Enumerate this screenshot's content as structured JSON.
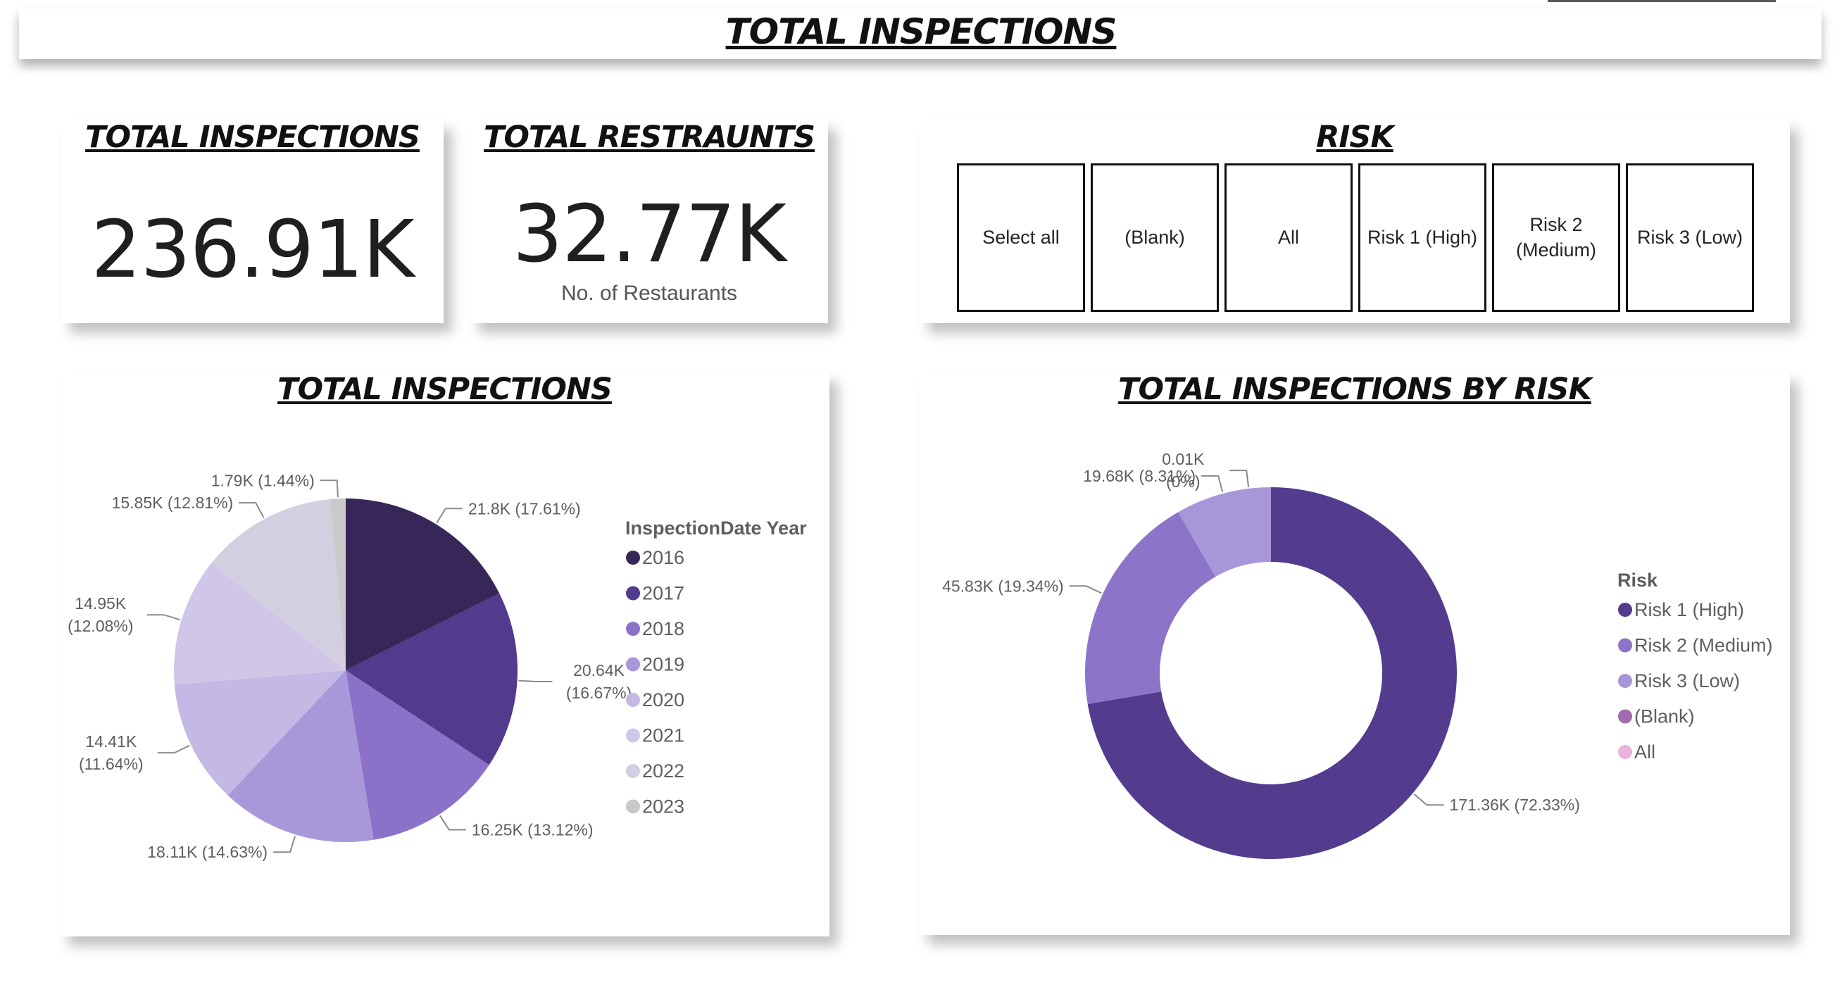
{
  "page": {
    "title": "TOTAL INSPECTIONS"
  },
  "kpis": {
    "inspections": {
      "title": "TOTAL INSPECTIONS",
      "value": "236.91K"
    },
    "restaurants": {
      "title": "TOTAL RESTRAUNTS",
      "value": "32.77K",
      "caption": "No. of Restaurants"
    }
  },
  "risk_slicer": {
    "title": "RISK",
    "options": [
      "Select all",
      "(Blank)",
      "All",
      "Risk 1 (High)",
      "Risk 2\n(Medium)",
      "Risk 3 (Low)"
    ]
  },
  "chart_data": [
    {
      "type": "pie",
      "title": "TOTAL INSPECTIONS",
      "legend_title": "InspectionDate Year",
      "legend_position": "right",
      "slices": [
        {
          "name": "2016",
          "value": 21.8,
          "label": "21.8K (17.61%)",
          "color": "#372759"
        },
        {
          "name": "2017",
          "value": 20.64,
          "label": [
            "20.64K",
            "(16.67%)"
          ],
          "color": "#523B8C"
        },
        {
          "name": "2018",
          "value": 16.25,
          "label": "16.25K (13.12%)",
          "color": "#8B72C8"
        },
        {
          "name": "2019",
          "value": 18.11,
          "label": "18.11K (14.63%)",
          "color": "#A898D9"
        },
        {
          "name": "2020",
          "value": 14.41,
          "label": [
            "14.41K",
            "(11.64%)"
          ],
          "color": "#C4B8E4"
        },
        {
          "name": "2021",
          "value": 14.95,
          "label": [
            "14.95K",
            "(12.08%)"
          ],
          "color": "#D0C7E8"
        },
        {
          "name": "2022",
          "value": 15.85,
          "label": "15.85K (12.81%)",
          "color": "#D3CFE1"
        },
        {
          "name": "2023",
          "value": 1.79,
          "label": "1.79K (1.44%)",
          "color": "#C9C9C9"
        }
      ]
    },
    {
      "type": "donut",
      "title": "TOTAL INSPECTIONS BY RISK",
      "legend_title": "Risk",
      "legend_position": "right",
      "slices": [
        {
          "name": "Risk 1 (High)",
          "value": 171.36,
          "label": "171.36K (72.33%)",
          "color": "#533C8D"
        },
        {
          "name": "Risk 2 (Medium)",
          "value": 45.83,
          "label": "45.83K (19.34%)",
          "color": "#8C74C9"
        },
        {
          "name": "Risk 3 (Low)",
          "value": 19.68,
          "label": "19.68K (8.31%)",
          "color": "#A897D8"
        },
        {
          "name": "(Blank)",
          "value": 0.01,
          "label": [
            "0.01K",
            "(0%)"
          ],
          "color": "#A36AAE"
        },
        {
          "name": "All",
          "value": 0.0,
          "label": "",
          "color": "#E9B3DA"
        }
      ]
    }
  ]
}
